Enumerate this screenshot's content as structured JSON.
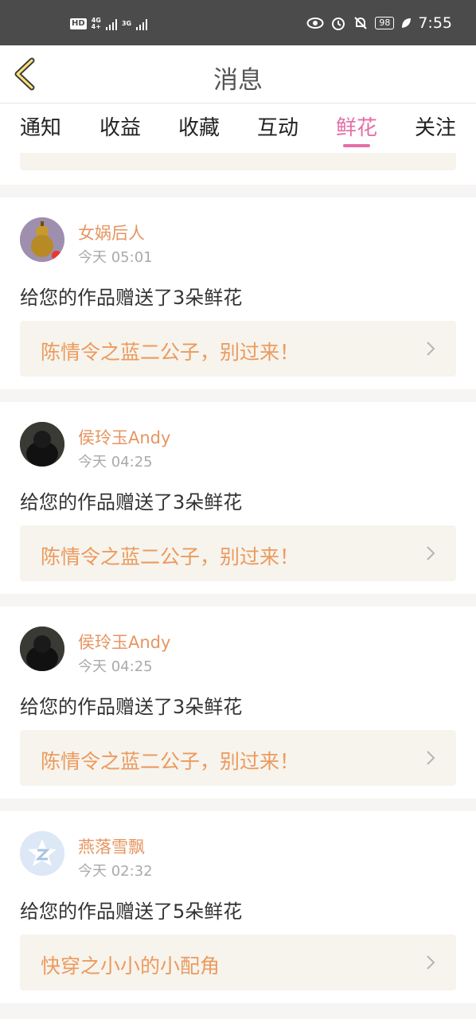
{
  "status_bar": {
    "hd": "HD",
    "net1_top": "4G",
    "net1_bottom": "4+",
    "net2_top": "3G",
    "battery": "98",
    "time": "7:55"
  },
  "header": {
    "title": "消息"
  },
  "tabs": [
    {
      "label": "通知"
    },
    {
      "label": "收益"
    },
    {
      "label": "收藏"
    },
    {
      "label": "互动"
    },
    {
      "label": "鲜花"
    },
    {
      "label": "关注"
    }
  ],
  "active_tab": "鲜花",
  "colors": {
    "accent": "#e46fa6",
    "name": "#e79561",
    "link": "#ec9a5e"
  },
  "messages": [
    {
      "user": "女娲后人",
      "time": "今天 05:01",
      "text": "给您的作品赠送了3朵鲜花",
      "work": "陈情令之蓝二公子，别过来！"
    },
    {
      "user": "侯玲玉Andy",
      "time": "今天 04:25",
      "text": "给您的作品赠送了3朵鲜花",
      "work": "陈情令之蓝二公子，别过来！"
    },
    {
      "user": "侯玲玉Andy",
      "time": "今天 04:25",
      "text": "给您的作品赠送了3朵鲜花",
      "work": "陈情令之蓝二公子，别过来！"
    },
    {
      "user": "燕落雪飘",
      "time": "今天 02:32",
      "text": "给您的作品赠送了5朵鲜花",
      "work": "快穿之小小的小配角"
    }
  ]
}
